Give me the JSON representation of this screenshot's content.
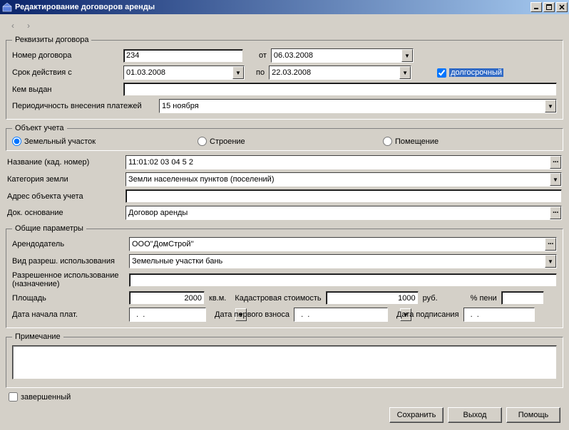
{
  "window": {
    "title": "Редактирование договоров аренды"
  },
  "requisites": {
    "legend": "Реквизиты договора",
    "number_label": "Номер договора",
    "number": "234",
    "from_label": "от",
    "from_date": "06.03.2008",
    "term_label": "Срок действия с",
    "term_from": "01.03.2008",
    "term_to_label": "по",
    "term_to": "22.03.2008",
    "longterm_label": "долгосрочный",
    "issued_label": "Кем выдан",
    "issued": "",
    "periodicity_label": "Периодичность внесения платежей",
    "periodicity": "15 ноября"
  },
  "object": {
    "legend": "Объект учета",
    "radios": {
      "land": "Земельный участок",
      "building": "Строение",
      "room": "Помещение"
    },
    "name_label": "Название (кад. номер)",
    "name": "11:01:02 03 04 5 2",
    "category_label": "Категория земли",
    "category": "Земли населенных пунктов (поселений)",
    "address_label": "Адрес объекта учета",
    "address": "",
    "basis_label": "Док. основание",
    "basis": "Договор аренды"
  },
  "common": {
    "legend": "Общие параметры",
    "lessor_label": "Арендодатель",
    "lessor": "ООО''ДомСтрой''",
    "permitted_label": "Вид разреш. использования",
    "permitted": "Земельные участки бань",
    "purpose_label": "Разрешенное использование (назначение)",
    "purpose": "",
    "area_label": "Площадь",
    "area": "2000",
    "area_unit": "кв.м.",
    "cadastral_label": "Кадастровая стоимость",
    "cadastral": "1000",
    "cadastral_unit": "руб.",
    "penalty_label": "% пени",
    "penalty": "",
    "pay_start_label": "Дата начала плат.",
    "pay_start": "  .  .",
    "first_pay_label": "Дата первого взноса",
    "first_pay": "  .  .",
    "sign_label": "Дата подписания",
    "sign": "  .  ."
  },
  "note": {
    "legend": "Примечание",
    "text": ""
  },
  "completed_label": "завершенный",
  "buttons": {
    "save": "Сохранить",
    "exit": "Выход",
    "help": "Помощь"
  }
}
